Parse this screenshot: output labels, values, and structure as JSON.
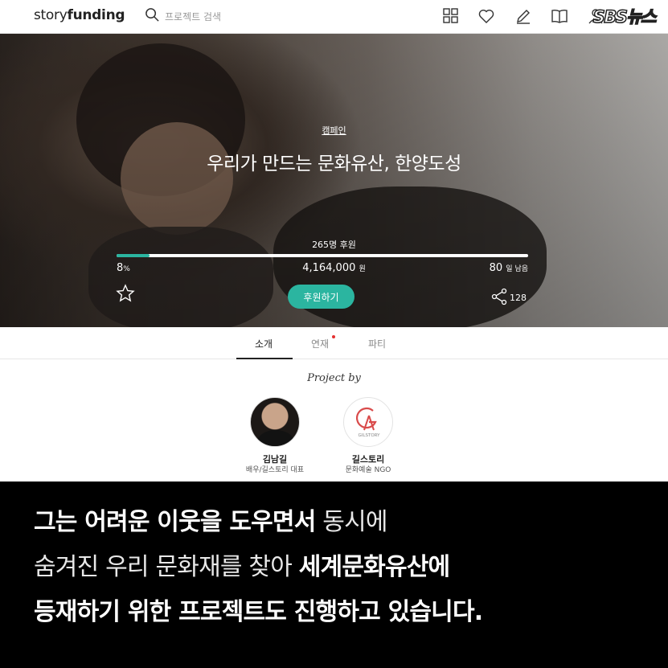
{
  "header": {
    "logo_regular": "story",
    "logo_bold": "funding",
    "search_placeholder": "프로젝트 검색",
    "icons": [
      "grid-icon",
      "heart-icon",
      "pencil-icon",
      "book-icon",
      "user-icon"
    ],
    "watermark": "SBS뉴스"
  },
  "hero": {
    "category": "캠페인",
    "title": "우리가 만드는 문화유산, 한양도성",
    "backers": "265명 후원",
    "progress_percent": 8,
    "percent_value": "8",
    "percent_unit": "%",
    "amount_value": "4,164,000",
    "amount_unit": "원",
    "days_value": "80",
    "days_unit": "일 남음",
    "fund_button": "후원하기",
    "share_count": "128",
    "accent_color": "#2bb5a0"
  },
  "tabs": [
    {
      "label": "소개",
      "active": true
    },
    {
      "label": "연재",
      "active": false,
      "has_new": true
    },
    {
      "label": "파티",
      "active": false
    }
  ],
  "creators": {
    "heading": "Project by",
    "items": [
      {
        "name": "김남길",
        "role": "배우/길스토리 대표"
      },
      {
        "name": "길스토리",
        "role": "문화예술 NGO",
        "logo_text": "GILSTORY"
      }
    ]
  },
  "caption": {
    "line1_bold": "그는 어려운 이웃을 도우면서",
    "line1_thin": " 동시에",
    "line2_thin": "숨겨진 우리 문화재를 찾아 ",
    "line2_bold": "세계문화유산에",
    "line3_bold": "등재하기 위한 프로젝트도 진행하고 있습니다."
  }
}
